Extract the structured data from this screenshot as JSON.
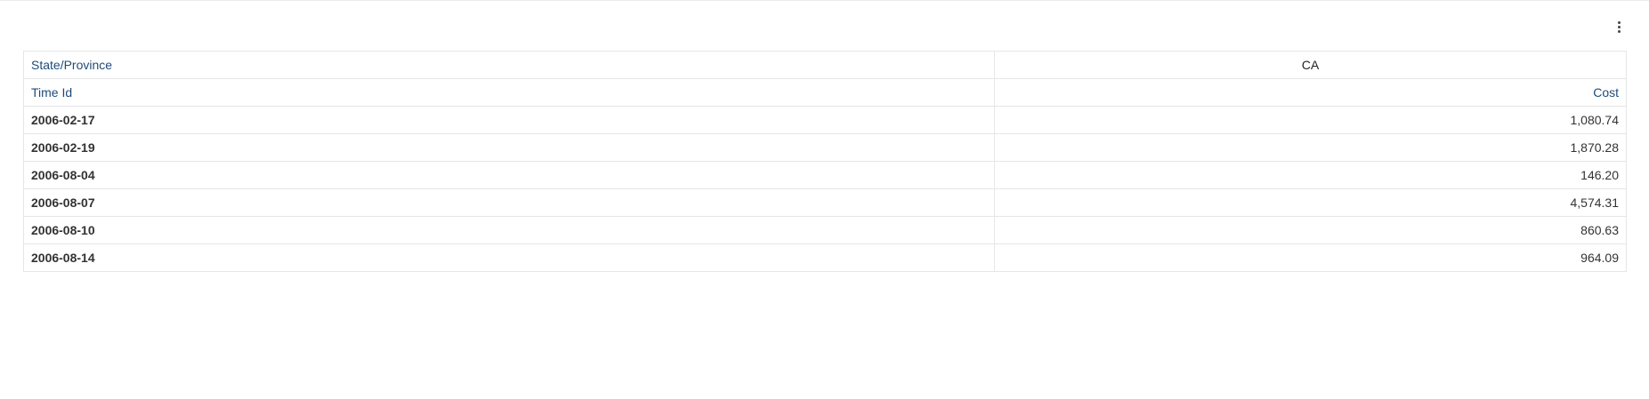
{
  "pivot": {
    "column_dimension_label": "State/Province",
    "column_dimension_value": "CA",
    "row_dimension_label": "Time Id",
    "measure_label": "Cost",
    "rows": [
      {
        "time_id": "2006-02-17",
        "cost": "1,080.74"
      },
      {
        "time_id": "2006-02-19",
        "cost": "1,870.28"
      },
      {
        "time_id": "2006-08-04",
        "cost": "146.20"
      },
      {
        "time_id": "2006-08-07",
        "cost": "4,574.31"
      },
      {
        "time_id": "2006-08-10",
        "cost": "860.63"
      },
      {
        "time_id": "2006-08-14",
        "cost": "964.09"
      }
    ]
  },
  "icons": {
    "menu": "vertical-ellipsis-icon"
  }
}
